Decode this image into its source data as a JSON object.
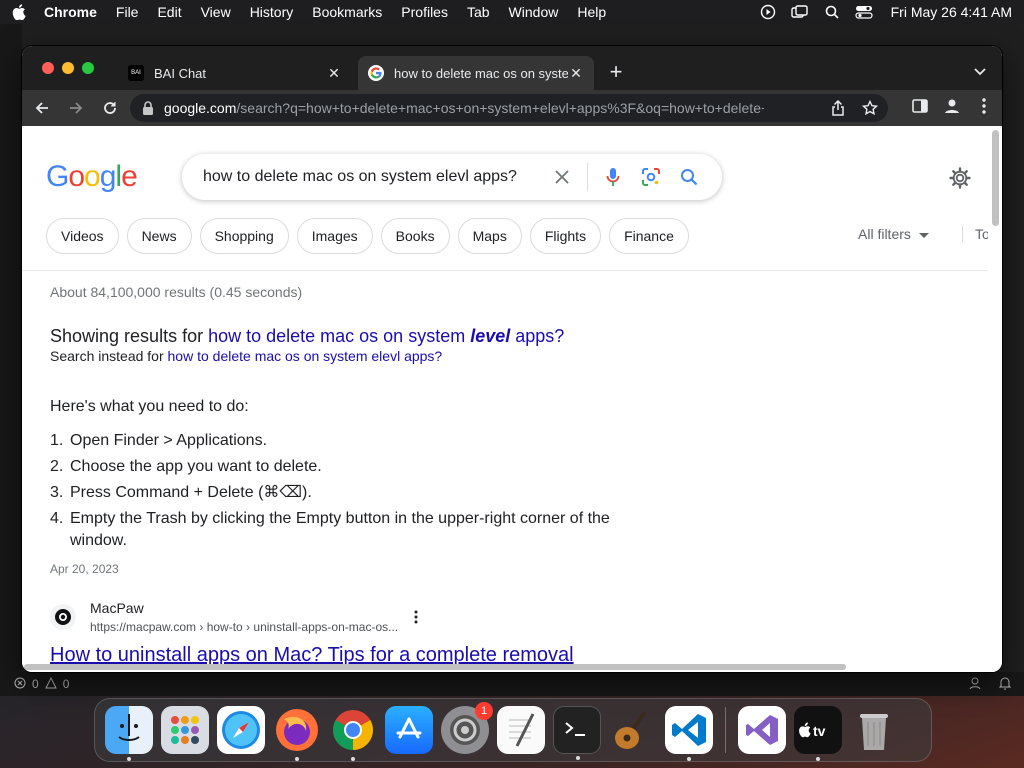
{
  "menubar": {
    "items": [
      "Chrome",
      "File",
      "Edit",
      "View",
      "History",
      "Bookmarks",
      "Profiles",
      "Tab",
      "Window",
      "Help"
    ],
    "clock": "Fri May 26  4:41 AM"
  },
  "editor": {
    "status_errors": "0",
    "status_warnings": "0"
  },
  "tabs": [
    {
      "title": "BAI Chat",
      "favicon_text": "BAI"
    },
    {
      "title": "how to delete mac os on syster"
    }
  ],
  "omnibox": {
    "domain": "google.com",
    "path": "/search?q=how+to+delete+mac+os+on+system+elevl+apps%3F&oq=how+to+delete+..."
  },
  "search": {
    "query": "how to delete mac os on system elevl apps?",
    "logo": [
      "G",
      "o",
      "o",
      "g",
      "l",
      "e"
    ]
  },
  "chips": [
    "Videos",
    "News",
    "Shopping",
    "Images",
    "Books",
    "Maps",
    "Flights",
    "Finance"
  ],
  "filters": {
    "all_filters": "All filters",
    "tools": "Tools"
  },
  "results": {
    "stats": "About 84,100,000 results (0.45 seconds)",
    "showing_prefix": "Showing results for ",
    "showing_link_a": "how to delete mac os on system ",
    "showing_link_em": "level",
    "showing_link_b": " apps?",
    "instead_prefix": "Search instead for ",
    "instead_link": "how to delete mac os on system elevl apps?",
    "snippet_head": "Here's what you need to do:",
    "steps": [
      {
        "num": "1.",
        "text": "Open Finder > Applications."
      },
      {
        "num": "2.",
        "text": "Choose the app you want to delete."
      },
      {
        "num": "3.",
        "text": "Press Command + Delete (⌘⌫)."
      },
      {
        "num": "4.",
        "text": "Empty the Trash by clicking the Empty button in the upper-right corner of the window."
      }
    ],
    "date": "Apr 20, 2023",
    "source_name": "MacPaw",
    "source_url": "https://macpaw.com › how-to › uninstall-apps-on-mac-os...",
    "result_title": "How to uninstall apps on Mac? Tips for a complete removal"
  },
  "dock": {
    "settings_badge": "1",
    "apps": [
      "Finder",
      "Launchpad",
      "Safari",
      "Firefox",
      "Chrome",
      "App Store",
      "System Settings",
      "TextEdit",
      "Terminal",
      "GarageBand",
      "Visual Studio Code",
      "Visual Studio",
      "TV",
      "Trash"
    ]
  },
  "colors": {
    "link": "#1a0dab",
    "chrome_dark": "#1f1f1f",
    "chrome_toolbar": "#353535"
  }
}
